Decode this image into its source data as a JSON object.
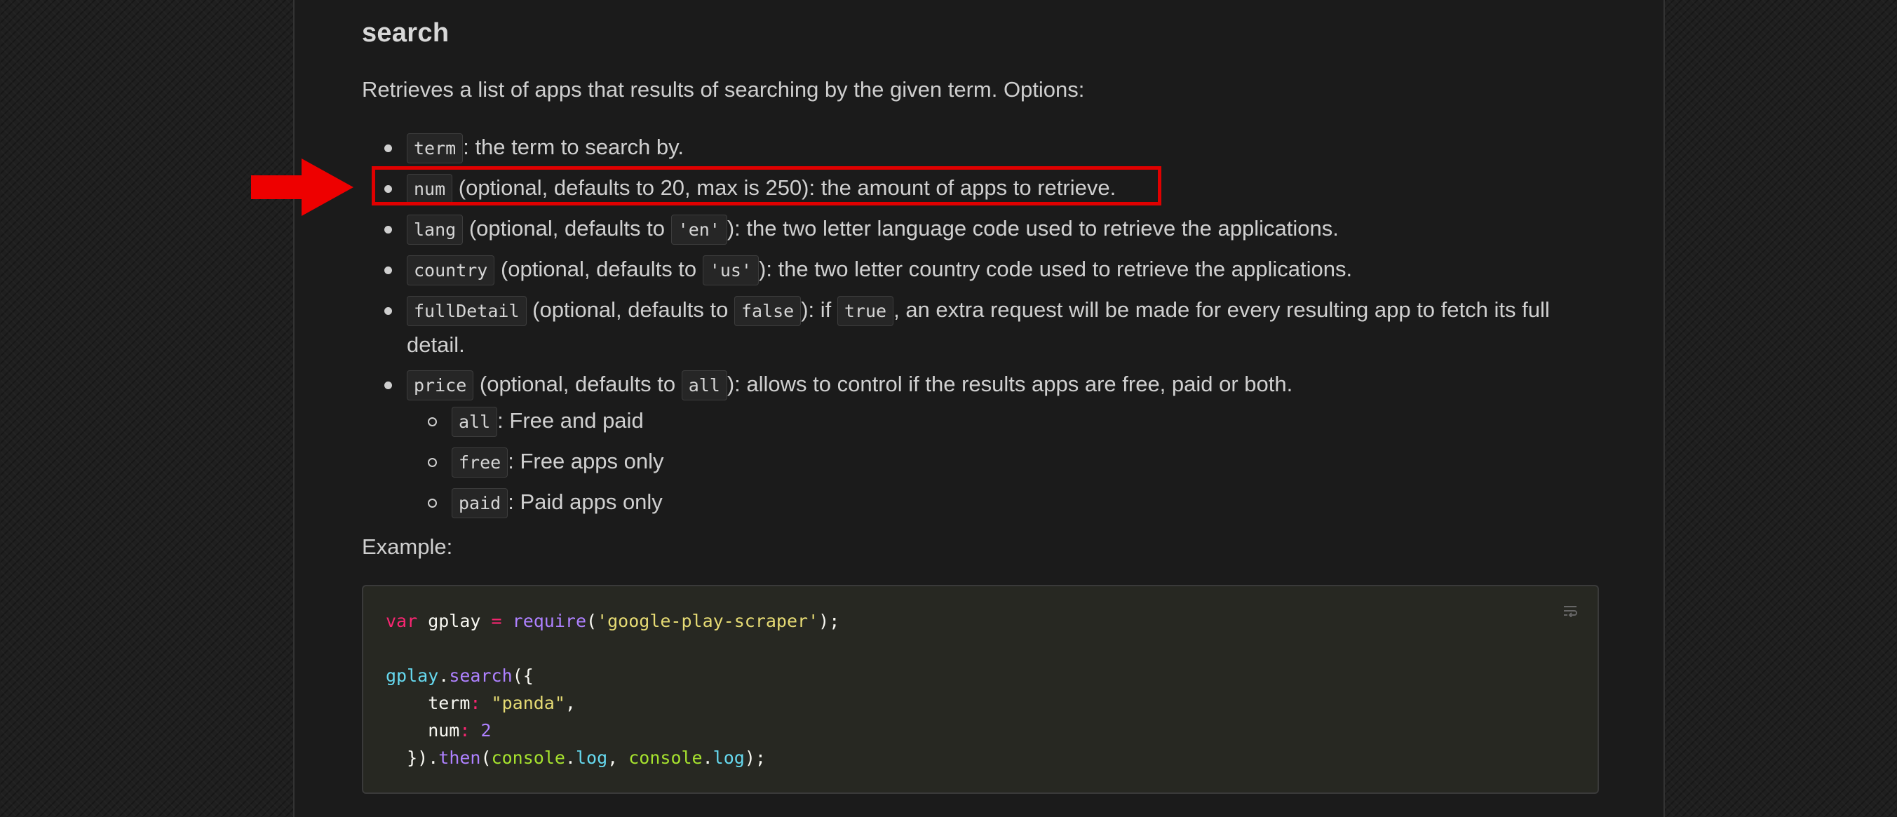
{
  "section": {
    "title": "search",
    "description": "Retrieves a list of apps that results of searching by the given term. Options:"
  },
  "options": [
    {
      "code": "term",
      "text": ": the term to search by."
    },
    {
      "code": "num",
      "text": " (optional, defaults to 20, max is 250): the amount of apps to retrieve."
    },
    {
      "code": "lang",
      "pre": " (optional, defaults to ",
      "code2": "'en'",
      "text": "): the two letter language code used to retrieve the applications."
    },
    {
      "code": "country",
      "pre": " (optional, defaults to ",
      "code2": "'us'",
      "text": "): the two letter country code used to retrieve the applications."
    },
    {
      "code": "fullDetail",
      "pre": " (optional, defaults to ",
      "code2": "false",
      "mid": "): if ",
      "code3": "true",
      "text": ", an extra request will be made for every resulting app to fetch its full detail."
    },
    {
      "code": "price",
      "pre": " (optional, defaults to ",
      "code2": "all",
      "text": "): allows to control if the results apps are free, paid or both."
    }
  ],
  "price_values": [
    {
      "code": "all",
      "text": ": Free and paid"
    },
    {
      "code": "free",
      "text": ": Free apps only"
    },
    {
      "code": "paid",
      "text": ": Paid apps only"
    }
  ],
  "example_label": "Example:",
  "code": {
    "l1_kw": "var",
    "l1_name": " gplay ",
    "l1_eq": "=",
    "l1_fn": "require",
    "l1_open": "(",
    "l1_str": "'google-play-scraper'",
    "l1_close": ");",
    "l2_obj": "gplay",
    "l2_dot": ".",
    "l2_fn": "search",
    "l2_open": "({",
    "l3_key": "    term",
    "l3_colon": ":",
    "l3_str": " \"panda\"",
    "l3_comma": ",",
    "l4_key": "    num",
    "l4_colon": ":",
    "l4_num": " 2",
    "l5_close": "  })",
    "l5_dot": ".",
    "l5_fn": "then",
    "l5_open": "(",
    "l5_a1": "console",
    "l5_d1": ".",
    "l5_m1": "log",
    "l5_sep": ", ",
    "l5_a2": "console",
    "l5_d2": ".",
    "l5_m2": "log",
    "l5_end": ");"
  },
  "colors": {
    "highlight": "#e00000",
    "keyword": "#f92672",
    "string": "#e6db74"
  }
}
